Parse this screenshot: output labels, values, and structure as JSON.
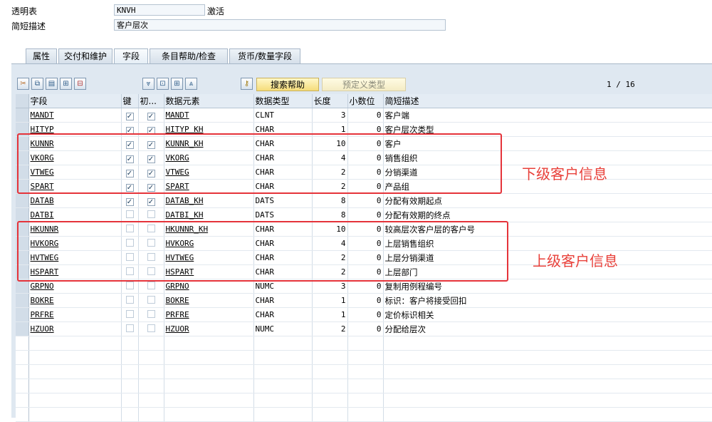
{
  "header": {
    "table_label": "透明表",
    "table_value": "KNVH",
    "status": "激活",
    "desc_label": "简短描述",
    "desc_value": "客户层次"
  },
  "tabs": [
    "属性",
    "交付和维护",
    "字段",
    "条目帮助/检查",
    "货币/数量字段"
  ],
  "active_tab": "字段",
  "toolbar": {
    "search_help": "搜索帮助",
    "predefined_type": "预定义类型",
    "pager": "1 / 16"
  },
  "columns": [
    "字段",
    "键",
    "初...",
    "数据元素",
    "数据类型",
    "长度",
    "小数位",
    "简短描述"
  ],
  "rows": [
    {
      "field": "MANDT",
      "key": true,
      "init": true,
      "element": "MANDT",
      "type": "CLNT",
      "len": "3",
      "dec": "0",
      "desc": "客户端"
    },
    {
      "field": "HITYP",
      "key": true,
      "init": true,
      "element": "HITYP_KH",
      "type": "CHAR",
      "len": "1",
      "dec": "0",
      "desc": "客户层次类型"
    },
    {
      "field": "KUNNR",
      "key": true,
      "init": true,
      "element": "KUNNR_KH",
      "type": "CHAR",
      "len": "10",
      "dec": "0",
      "desc": "客户"
    },
    {
      "field": "VKORG",
      "key": true,
      "init": true,
      "element": "VKORG",
      "type": "CHAR",
      "len": "4",
      "dec": "0",
      "desc": "销售组织"
    },
    {
      "field": "VTWEG",
      "key": true,
      "init": true,
      "element": "VTWEG",
      "type": "CHAR",
      "len": "2",
      "dec": "0",
      "desc": "分销渠道"
    },
    {
      "field": "SPART",
      "key": true,
      "init": true,
      "element": "SPART",
      "type": "CHAR",
      "len": "2",
      "dec": "0",
      "desc": "产品组"
    },
    {
      "field": "DATAB",
      "key": true,
      "init": true,
      "element": "DATAB_KH",
      "type": "DATS",
      "len": "8",
      "dec": "0",
      "desc": "分配有效期起点"
    },
    {
      "field": "DATBI",
      "key": false,
      "init": false,
      "element": "DATBI_KH",
      "type": "DATS",
      "len": "8",
      "dec": "0",
      "desc": "分配有效期的终点"
    },
    {
      "field": "HKUNNR",
      "key": false,
      "init": false,
      "element": "HKUNNR_KH",
      "type": "CHAR",
      "len": "10",
      "dec": "0",
      "desc": "较高层次客户层的客户号"
    },
    {
      "field": "HVKORG",
      "key": false,
      "init": false,
      "element": "HVKORG",
      "type": "CHAR",
      "len": "4",
      "dec": "0",
      "desc": "上层销售组织"
    },
    {
      "field": "HVTWEG",
      "key": false,
      "init": false,
      "element": "HVTWEG",
      "type": "CHAR",
      "len": "2",
      "dec": "0",
      "desc": "上层分销渠道"
    },
    {
      "field": "HSPART",
      "key": false,
      "init": false,
      "element": "HSPART",
      "type": "CHAR",
      "len": "2",
      "dec": "0",
      "desc": "上层部门"
    },
    {
      "field": "GRPNO",
      "key": false,
      "init": false,
      "element": "GRPNO",
      "type": "NUMC",
      "len": "3",
      "dec": "0",
      "desc": "复制用例程编号"
    },
    {
      "field": "BOKRE",
      "key": false,
      "init": false,
      "element": "BOKRE",
      "type": "CHAR",
      "len": "1",
      "dec": "0",
      "desc": "标识：客户将接受回扣"
    },
    {
      "field": "PRFRE",
      "key": false,
      "init": false,
      "element": "PRFRE",
      "type": "CHAR",
      "len": "1",
      "dec": "0",
      "desc": "定价标识相关"
    },
    {
      "field": "HZUOR",
      "key": false,
      "init": false,
      "element": "HZUOR",
      "type": "NUMC",
      "len": "2",
      "dec": "0",
      "desc": "分配给层次"
    }
  ],
  "empty_rows": 6,
  "annotations": {
    "lower": "下级客户信息",
    "upper": "上级客户信息",
    "color": "#e5333a"
  }
}
